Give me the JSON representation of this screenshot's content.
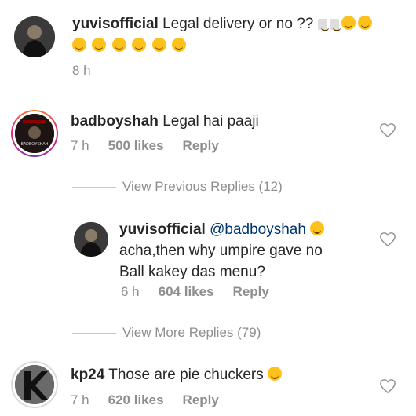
{
  "comments": [
    {
      "username": "yuvisofficial",
      "text": "Legal delivery or no ??",
      "emoji_row": "🤔🤔🤔🤔🤣🤣🤣",
      "time": "8 h"
    },
    {
      "username": "badboyshah",
      "text": "Legal hai paaji",
      "time": "7 h",
      "likes": "500 likes",
      "reply": "Reply"
    },
    {
      "username": "yuvisofficial",
      "mention": "@badboyshah",
      "text_line2": "acha,then why umpire gave no",
      "text_line3": "Ball kakey das menu?",
      "time": "6 h",
      "likes": "604 likes",
      "reply": "Reply"
    },
    {
      "username": "kp24",
      "text": "Those are pie chuckers",
      "time": "7 h",
      "likes": "620 likes",
      "reply": "Reply"
    }
  ],
  "view_previous": "View Previous Replies (12)",
  "view_more": "View More Replies (79)",
  "avatar_labels": {
    "badboyshah_overlay": "BADBOYSHAH"
  }
}
